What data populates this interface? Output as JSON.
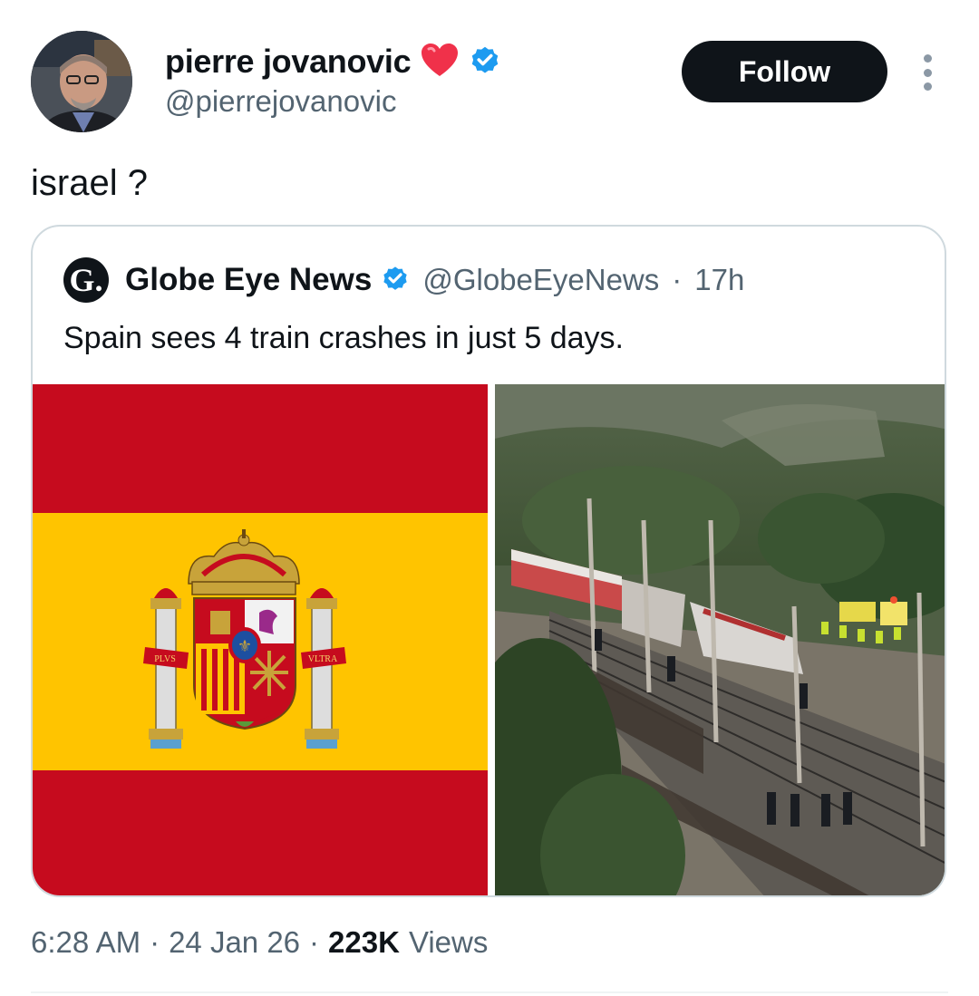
{
  "author": {
    "name": "pierre jovanovic",
    "handle": "@pierrejovanovic",
    "badge_emoji_icon": "heart-icon",
    "verified_icon": "verified-badge-icon",
    "verified_color": "#1d9bf0"
  },
  "follow_button": {
    "label": "Follow"
  },
  "tweet": {
    "text": "israel ?"
  },
  "quoted_tweet": {
    "logo_letter": "G.",
    "name": "Globe Eye News",
    "handle": "@GlobeEyeNews",
    "separator": "·",
    "age": "17h",
    "text": "Spain sees 4 train crashes in just 5 days.",
    "flag_motto_left": "PLVS",
    "flag_motto_right": "VLTRA"
  },
  "meta": {
    "time": "6:28 AM",
    "sep1": "·",
    "date": "24 Jan 26",
    "sep2": "·",
    "views_count": "223K",
    "views_label": "Views"
  },
  "colors": {
    "flag_red": "#c60b1e",
    "flag_yellow": "#ffc400",
    "text_primary": "#0f1419",
    "text_secondary": "#536471"
  }
}
